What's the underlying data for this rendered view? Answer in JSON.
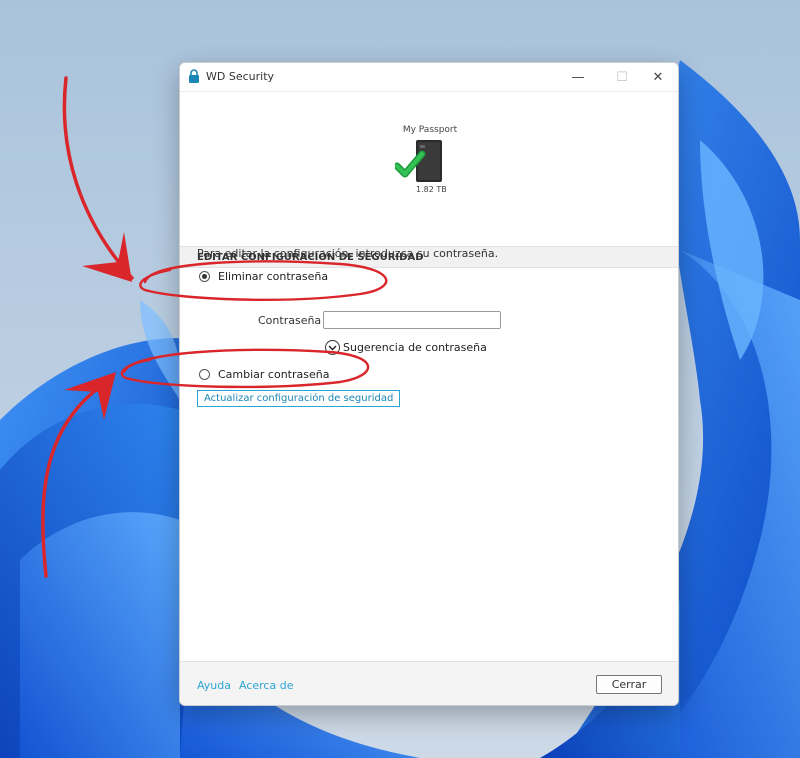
{
  "window": {
    "title": "WD Security",
    "minimize_glyph": "—",
    "maximize_glyph": "☐",
    "close_glyph": "✕"
  },
  "device": {
    "name": "My Passport",
    "capacity": "1.82 TB"
  },
  "section": {
    "header": "EDITAR CONFIGURACIÓN DE SEGURIDAD",
    "instructions": "Para editar la configuración, introduzca su contraseña."
  },
  "options": {
    "remove_password": {
      "label": "Eliminar contraseña",
      "selected": true
    },
    "change_password": {
      "label": "Cambiar contraseña",
      "selected": false
    }
  },
  "password": {
    "label": "Contraseña",
    "value": ""
  },
  "hint": {
    "label": "Sugerencia de contraseña",
    "icon_glyph": "⌄"
  },
  "update_button": "Actualizar configuración de seguridad",
  "footer": {
    "help": "Ayuda",
    "about": "Acerca de",
    "close": "Cerrar"
  },
  "icons": {
    "title_icon": "lock-icon",
    "drive": "external-drive-icon",
    "status": "checkmark-icon",
    "hint": "chevron-down-circle-icon"
  },
  "colors": {
    "accent": "#27a6d6",
    "check": "#27b04a",
    "annotation": "#d9262b",
    "wallpaper_blue": "#1f6fe0"
  }
}
